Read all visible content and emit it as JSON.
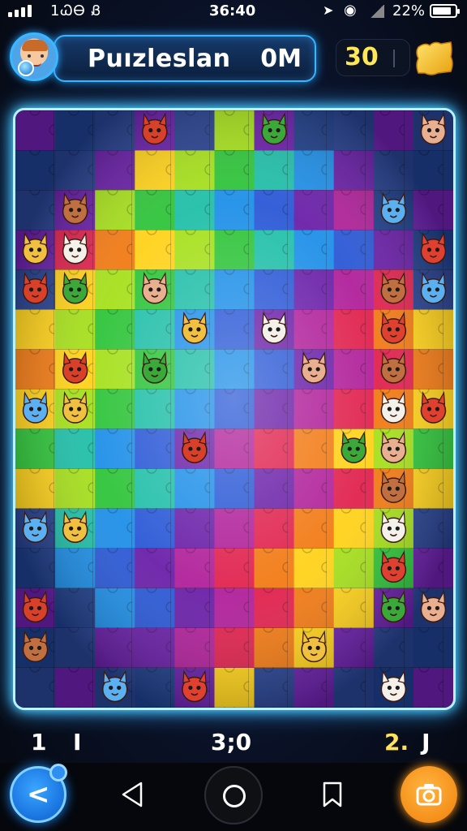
{
  "status_bar": {
    "network": "1ᏇᎾ Ᏸ",
    "time": "36:40",
    "location_icon": "location-arrow-icon",
    "wifi_icon": "wifi-icon",
    "battery_pct": "22%"
  },
  "header": {
    "title": "Puızleslan",
    "score": "0M",
    "coins": "30",
    "ticket_icon": "golden-ticket-icon"
  },
  "board": {
    "characters": [
      {
        "name": "fire-dragon",
        "color": "#d8402a"
      },
      {
        "name": "green-turtle",
        "color": "#3aa93a"
      },
      {
        "name": "feather-bird",
        "color": "#e8b090"
      },
      {
        "name": "fox-cub",
        "color": "#c07040"
      },
      {
        "name": "blue-fish",
        "color": "#5ab0f0"
      },
      {
        "name": "yellow-duck",
        "color": "#f0c040"
      },
      {
        "name": "white-cat",
        "color": "#f4f0ea"
      },
      {
        "name": "red-phoenix",
        "color": "#e04030"
      }
    ]
  },
  "footer": {
    "counter_left_1": "1",
    "counter_left_2": "I",
    "counter_middle": "3;0",
    "counter_right_value": "2.",
    "counter_right_suffix": "J"
  },
  "colors": {
    "accent": "#38b6ff",
    "frame_glow": "#b9f2ff",
    "coin_yellow": "#ffe75a",
    "camera_orange": "#f7931e"
  }
}
